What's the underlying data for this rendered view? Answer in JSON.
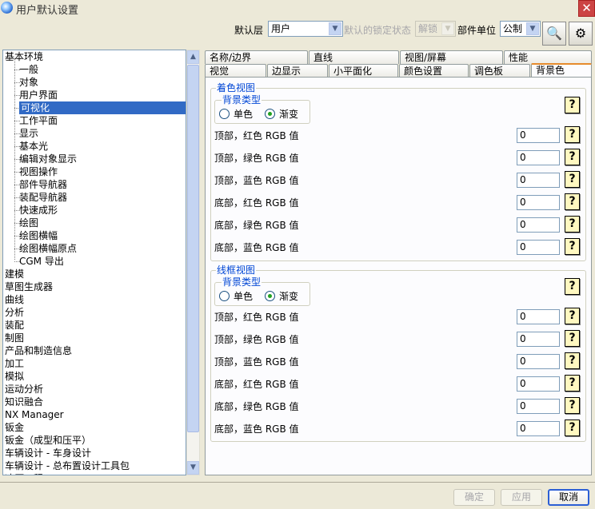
{
  "window": {
    "title": "用户默认设置",
    "close_glyph": "✕"
  },
  "toolbar": {
    "default_layer_label": "默认层",
    "default_layer_value": "用户",
    "lock_state_label": "默认的锁定状态",
    "lock_state_value": "解锁",
    "unit_label": "部件单位",
    "unit_value": "公制",
    "find_icon_glyph": "🔍",
    "settings_icon_glyph": "⚙"
  },
  "tree": {
    "items": [
      {
        "label": "基本环境",
        "level": 0
      },
      {
        "label": "一般",
        "level": 1
      },
      {
        "label": "对象",
        "level": 1
      },
      {
        "label": "用户界面",
        "level": 1
      },
      {
        "label": "可视化",
        "level": 1,
        "selected": true
      },
      {
        "label": "工作平面",
        "level": 1
      },
      {
        "label": "显示",
        "level": 1
      },
      {
        "label": "基本光",
        "level": 1
      },
      {
        "label": "编辑对象显示",
        "level": 1
      },
      {
        "label": "视图操作",
        "level": 1
      },
      {
        "label": "部件导航器",
        "level": 1
      },
      {
        "label": "装配导航器",
        "level": 1
      },
      {
        "label": "快速成形",
        "level": 1
      },
      {
        "label": "绘图",
        "level": 1
      },
      {
        "label": "绘图横幅",
        "level": 1
      },
      {
        "label": "绘图横幅原点",
        "level": 1
      },
      {
        "label": "CGM 导出",
        "level": 1
      },
      {
        "label": "建模",
        "level": 0
      },
      {
        "label": "草图生成器",
        "level": 0
      },
      {
        "label": "曲线",
        "level": 0
      },
      {
        "label": "分析",
        "level": 0
      },
      {
        "label": "装配",
        "level": 0
      },
      {
        "label": "制图",
        "level": 0
      },
      {
        "label": "产品和制造信息",
        "level": 0
      },
      {
        "label": "加工",
        "level": 0
      },
      {
        "label": "模拟",
        "level": 0
      },
      {
        "label": "运动分析",
        "level": 0
      },
      {
        "label": "知识融合",
        "level": 0
      },
      {
        "label": "NX Manager",
        "level": 0
      },
      {
        "label": "钣金",
        "level": 0
      },
      {
        "label": "钣金（成型和压平）",
        "level": 0
      },
      {
        "label": "车辆设计 - 车身设计",
        "level": 0
      },
      {
        "label": "车辆设计 - 总布置设计工具包",
        "level": 0
      },
      {
        "label": "冲压工程",
        "level": 0
      }
    ],
    "scroll_up_glyph": "▲",
    "scroll_down_glyph": "▼"
  },
  "tabs": {
    "row1": [
      "名称/边界",
      "直线",
      "视图/屏幕",
      "性能"
    ],
    "row2": [
      "视觉",
      "边显示",
      "小平面化",
      "颜色设置",
      "调色板",
      "背景色"
    ],
    "active": "背景色"
  },
  "shaded": {
    "title": "着色视图",
    "type_label": "背景类型",
    "opt_single": "单色",
    "opt_gradient": "渐变",
    "selected": "渐变",
    "rows": [
      {
        "label": "顶部，红色 RGB 值",
        "value": "0"
      },
      {
        "label": "顶部，绿色 RGB 值",
        "value": "0"
      },
      {
        "label": "顶部，蓝色 RGB 值",
        "value": "0"
      },
      {
        "label": "底部，红色 RGB 值",
        "value": "0"
      },
      {
        "label": "底部，绿色 RGB 值",
        "value": "0"
      },
      {
        "label": "底部，蓝色 RGB 值",
        "value": "0"
      }
    ]
  },
  "wireframe": {
    "title": "线框视图",
    "type_label": "背景类型",
    "opt_single": "单色",
    "opt_gradient": "渐变",
    "selected": "渐变",
    "rows": [
      {
        "label": "顶部，红色 RGB 值",
        "value": "0"
      },
      {
        "label": "顶部，绿色 RGB 值",
        "value": "0"
      },
      {
        "label": "顶部，蓝色 RGB 值",
        "value": "0"
      },
      {
        "label": "底部，红色 RGB 值",
        "value": "0"
      },
      {
        "label": "底部，绿色 RGB 值",
        "value": "0"
      },
      {
        "label": "底部，蓝色 RGB 值",
        "value": "0"
      }
    ]
  },
  "help_glyph": "?",
  "footer": {
    "ok": "确定",
    "apply": "应用",
    "cancel": "取消"
  }
}
